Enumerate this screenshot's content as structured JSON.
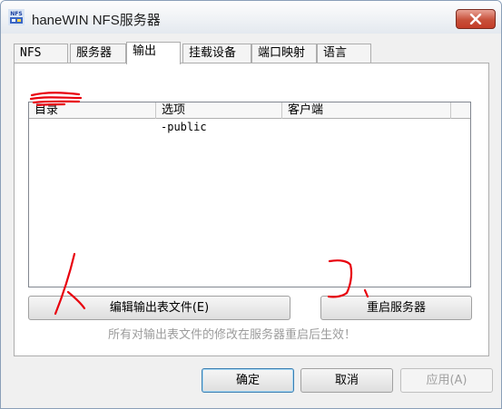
{
  "window": {
    "title": "haneWIN NFS服务器"
  },
  "tabs": [
    {
      "label": "NFS"
    },
    {
      "label": "服务器"
    },
    {
      "label": "输出"
    },
    {
      "label": "挂载设备"
    },
    {
      "label": "端口映射"
    },
    {
      "label": "语言"
    }
  ],
  "listview": {
    "columns": [
      "目录",
      "选项",
      "客户端"
    ],
    "rows": [
      {
        "directory": "",
        "options": "-public",
        "clients": ""
      }
    ]
  },
  "buttons": {
    "edit_exports": "编辑输出表文件(E)",
    "restart_server": "重启服务器",
    "ok": "确定",
    "cancel": "取消",
    "apply": "应用(A)"
  },
  "note": "所有对输出表文件的修改在服务器重启后生效！",
  "colors": {
    "annotation": "#e8000d",
    "close_button": "#c7503a"
  }
}
